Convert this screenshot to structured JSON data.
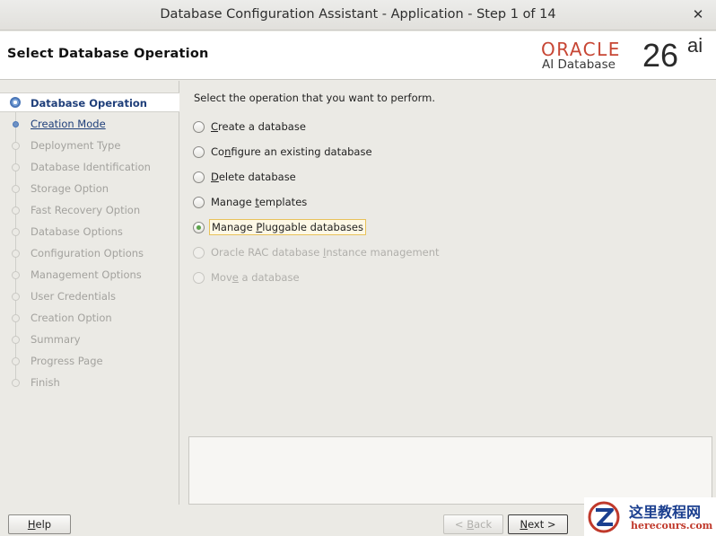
{
  "window": {
    "title": "Database Configuration Assistant - Application - Step 1 of 14",
    "close_glyph": "✕"
  },
  "header": {
    "page_title": "Select Database Operation",
    "logo": {
      "brand": "ORACLE",
      "product": "AI Database",
      "version": "26",
      "version_suffix": "ai",
      "brand_color": "#c74634"
    }
  },
  "sidebar": {
    "steps": [
      {
        "label": "Database Operation",
        "state": "current"
      },
      {
        "label": "Creation Mode",
        "state": "link"
      },
      {
        "label": "Deployment Type",
        "state": "disabled"
      },
      {
        "label": "Database Identification",
        "state": "disabled"
      },
      {
        "label": "Storage Option",
        "state": "disabled"
      },
      {
        "label": "Fast Recovery Option",
        "state": "disabled"
      },
      {
        "label": "Database Options",
        "state": "disabled"
      },
      {
        "label": "Configuration Options",
        "state": "disabled"
      },
      {
        "label": "Management Options",
        "state": "disabled"
      },
      {
        "label": "User Credentials",
        "state": "disabled"
      },
      {
        "label": "Creation Option",
        "state": "disabled"
      },
      {
        "label": "Summary",
        "state": "disabled"
      },
      {
        "label": "Progress Page",
        "state": "disabled"
      },
      {
        "label": "Finish",
        "state": "disabled"
      }
    ]
  },
  "main": {
    "instruction": "Select the operation that you want to perform.",
    "options": [
      {
        "pre": "",
        "key": "C",
        "post": "reate a database",
        "checked": false,
        "enabled": true
      },
      {
        "pre": "Co",
        "key": "n",
        "post": "figure an existing database",
        "checked": false,
        "enabled": true
      },
      {
        "pre": "",
        "key": "D",
        "post": "elete database",
        "checked": false,
        "enabled": true
      },
      {
        "pre": "Manage ",
        "key": "t",
        "post": "emplates",
        "checked": false,
        "enabled": true
      },
      {
        "pre": "Manage ",
        "key": "P",
        "post": "luggable databases",
        "checked": true,
        "enabled": true
      },
      {
        "pre": "Oracle RAC database ",
        "key": "I",
        "post": "nstance management",
        "checked": false,
        "enabled": false
      },
      {
        "pre": "Mov",
        "key": "e",
        "post": " a database",
        "checked": false,
        "enabled": false
      }
    ]
  },
  "footer": {
    "help": {
      "key": "H",
      "rest": "elp"
    },
    "back": {
      "pre": "< ",
      "key": "B",
      "rest": "ack"
    },
    "next": {
      "key": "N",
      "rest": "ext >"
    }
  },
  "watermark": {
    "name": "这里教程网",
    "url": "herecours.com"
  }
}
